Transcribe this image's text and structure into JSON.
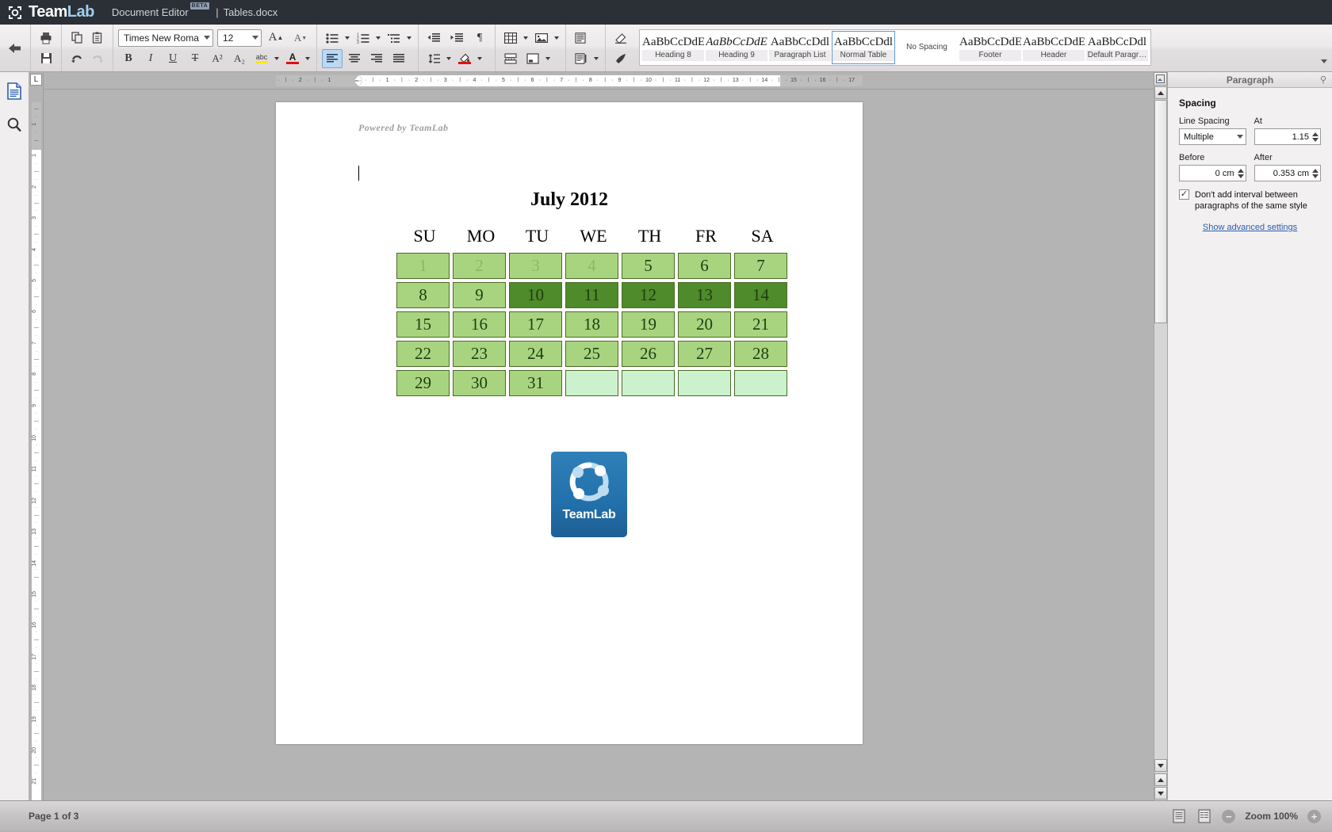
{
  "titlebar": {
    "brand_light": "Team",
    "brand_dark": "Lab",
    "app_title": "Document Editor",
    "beta_badge": "BETA",
    "separator": "|",
    "document_name": "Tables.docx"
  },
  "toolbar": {
    "back_icon": "back-arrow-icon",
    "print_icon": "print-icon",
    "save_icon": "save-icon",
    "copy_icon": "copy-icon",
    "paste_icon": "paste-icon",
    "undo_icon": "undo-icon",
    "redo_icon": "redo-icon",
    "font_name": "Times New Roman",
    "font_size": "12",
    "increase_font_icon": "increase-font-size-icon",
    "decrease_font_icon": "decrease-font-size-icon",
    "bold_label": "B",
    "italic_label": "I",
    "underline_label": "U",
    "strikethrough_label": "T",
    "superscript_label": "A²",
    "subscript_label": "A₂",
    "highlight_label": "abc",
    "fontcolor_label": "A",
    "bullets_icon": "bulleted-list-icon",
    "numbering_icon": "numbered-list-icon",
    "multilevel_icon": "multilevel-list-icon",
    "align_left_icon": "align-left-icon",
    "align_center_icon": "align-center-icon",
    "align_right_icon": "align-right-icon",
    "align_justify_icon": "align-justify-icon",
    "decrease_indent_icon": "decrease-indent-icon",
    "increase_indent_icon": "increase-indent-icon",
    "formatting_marks_icon": "paragraph-mark-icon",
    "line_spacing_icon": "line-spacing-icon",
    "shading_icon": "shading-color-icon",
    "table_icon": "insert-table-icon",
    "image_icon": "insert-image-icon",
    "pagebreak_icon": "page-break-icon",
    "textbox_icon": "text-box-icon",
    "header_footer_icon": "header-footer-icon",
    "page_settings_icon": "page-settings-icon",
    "clear_style_icon": "clear-style-icon",
    "format_painter_icon": "format-painter-icon",
    "gallery_more_icon": "gallery-expand-icon"
  },
  "styles": [
    {
      "preview": "AaBbCcDdE",
      "name": "Heading 8",
      "italic": false,
      "selected": false,
      "boxed": true
    },
    {
      "preview": "AaBbCcDdE",
      "name": "Heading 9",
      "italic": true,
      "selected": false,
      "boxed": true
    },
    {
      "preview": "AaBbCcDdl",
      "name": "Paragraph List",
      "italic": false,
      "selected": false,
      "boxed": true
    },
    {
      "preview": "AaBbCcDdl",
      "name": "Normal Table",
      "italic": false,
      "selected": true,
      "boxed": true
    },
    {
      "preview": "",
      "name": "No Spacing",
      "italic": false,
      "selected": false,
      "boxed": false
    },
    {
      "preview": "AaBbCcDdEe",
      "name": "Footer",
      "italic": false,
      "selected": false,
      "boxed": true
    },
    {
      "preview": "AaBbCcDdEe",
      "name": "Header",
      "italic": false,
      "selected": false,
      "boxed": true
    },
    {
      "preview": "AaBbCcDdl",
      "name": "Default Paragr…",
      "italic": false,
      "selected": false,
      "boxed": true
    }
  ],
  "leftbar": {
    "document_icon": "document-pages-icon",
    "search_icon": "search-icon"
  },
  "ruler": {
    "corner_label": "L",
    "horizontal_marks": [
      "2",
      "1",
      "1",
      "2",
      "3",
      "4",
      "5",
      "6",
      "7",
      "8",
      "9",
      "10",
      "11",
      "12",
      "13",
      "14",
      "15",
      "16",
      "17"
    ],
    "vertical_marks": [
      "1",
      "1",
      "2",
      "3",
      "4",
      "5",
      "6",
      "7",
      "8",
      "9",
      "10",
      "11",
      "12",
      "13",
      "14",
      "15",
      "16",
      "17",
      "18",
      "19",
      "20",
      "21"
    ]
  },
  "document": {
    "watermark": "Powered by TeamLab",
    "calendar": {
      "title": "July 2012",
      "weekdays": [
        "SU",
        "MO",
        "TU",
        "WE",
        "TH",
        "FR",
        "SA"
      ],
      "rows": [
        [
          {
            "day": "1",
            "fill": "#a9d47f",
            "text": "#8aba5f"
          },
          {
            "day": "2",
            "fill": "#a9d47f",
            "text": "#8aba5f"
          },
          {
            "day": "3",
            "fill": "#a9d47f",
            "text": "#8aba5f"
          },
          {
            "day": "4",
            "fill": "#a9d47f",
            "text": "#8aba5f"
          },
          {
            "day": "5",
            "fill": "#a9d47f",
            "text": "#1d3d12"
          },
          {
            "day": "6",
            "fill": "#a9d47f",
            "text": "#1d3d12"
          },
          {
            "day": "7",
            "fill": "#a9d47f",
            "text": "#1d3d12"
          }
        ],
        [
          {
            "day": "8",
            "fill": "#a9d47f",
            "text": "#1d3d12"
          },
          {
            "day": "9",
            "fill": "#a9d47f",
            "text": "#1d3d12"
          },
          {
            "day": "10",
            "fill": "#4f8a2b",
            "text": "#1d3d12"
          },
          {
            "day": "11",
            "fill": "#4f8a2b",
            "text": "#1d3d12"
          },
          {
            "day": "12",
            "fill": "#4f8a2b",
            "text": "#1d3d12"
          },
          {
            "day": "13",
            "fill": "#4f8a2b",
            "text": "#1d3d12"
          },
          {
            "day": "14",
            "fill": "#4f8a2b",
            "text": "#1d3d12"
          }
        ],
        [
          {
            "day": "15",
            "fill": "#a9d47f",
            "text": "#1d3d12"
          },
          {
            "day": "16",
            "fill": "#a9d47f",
            "text": "#1d3d12"
          },
          {
            "day": "17",
            "fill": "#a9d47f",
            "text": "#1d3d12"
          },
          {
            "day": "18",
            "fill": "#a9d47f",
            "text": "#1d3d12"
          },
          {
            "day": "19",
            "fill": "#a9d47f",
            "text": "#1d3d12"
          },
          {
            "day": "20",
            "fill": "#a9d47f",
            "text": "#1d3d12"
          },
          {
            "day": "21",
            "fill": "#a9d47f",
            "text": "#1d3d12"
          }
        ],
        [
          {
            "day": "22",
            "fill": "#a9d47f",
            "text": "#1d3d12"
          },
          {
            "day": "23",
            "fill": "#a9d47f",
            "text": "#1d3d12"
          },
          {
            "day": "24",
            "fill": "#a9d47f",
            "text": "#1d3d12"
          },
          {
            "day": "25",
            "fill": "#a9d47f",
            "text": "#1d3d12"
          },
          {
            "day": "26",
            "fill": "#a9d47f",
            "text": "#1d3d12"
          },
          {
            "day": "27",
            "fill": "#a9d47f",
            "text": "#1d3d12"
          },
          {
            "day": "28",
            "fill": "#a9d47f",
            "text": "#1d3d12"
          }
        ],
        [
          {
            "day": "29",
            "fill": "#a9d47f",
            "text": "#1d3d12"
          },
          {
            "day": "30",
            "fill": "#a9d47f",
            "text": "#1d3d12"
          },
          {
            "day": "31",
            "fill": "#a9d47f",
            "text": "#1d3d12"
          },
          {
            "day": "",
            "fill": "#ccf2cd",
            "text": "#1d3d12"
          },
          {
            "day": "",
            "fill": "#ccf2cd",
            "text": "#1d3d12"
          },
          {
            "day": "",
            "fill": "#ccf2cd",
            "text": "#1d3d12"
          },
          {
            "day": "",
            "fill": "#ccf2cd",
            "text": "#1d3d12"
          }
        ]
      ]
    },
    "image": {
      "alt": "teamlab-logo-image",
      "caption": "TeamLab"
    }
  },
  "right_panel": {
    "title": "Paragraph",
    "pin_icon": "pin-icon",
    "section_title": "Spacing",
    "line_spacing_label": "Line Spacing",
    "line_spacing_value": "Multiple",
    "at_label": "At",
    "at_value": "1.15",
    "before_label": "Before",
    "before_value": "0 cm",
    "after_label": "After",
    "after_value": "0.353 cm",
    "checkbox_checked": true,
    "checkbox_label": "Don't add interval between paragraphs of the same style",
    "advanced_link": "Show advanced settings"
  },
  "statusbar": {
    "page_status": "Page 1 of 3",
    "view_icon_1": "page-view-icon",
    "view_icon_2": "reading-view-icon",
    "zoom_out_label": "−",
    "zoom_label": "Zoom 100%",
    "zoom_in_label": "+"
  },
  "colors": {
    "titlebar_bg": "#2b2f36",
    "brand_accent": "#9fd0ef",
    "selection_blue": "#5b9bd5",
    "calendar_light": "#a9d47f",
    "calendar_dark": "#4f8a2b",
    "calendar_empty": "#ccf2cd",
    "link_blue": "#2a5db0"
  }
}
